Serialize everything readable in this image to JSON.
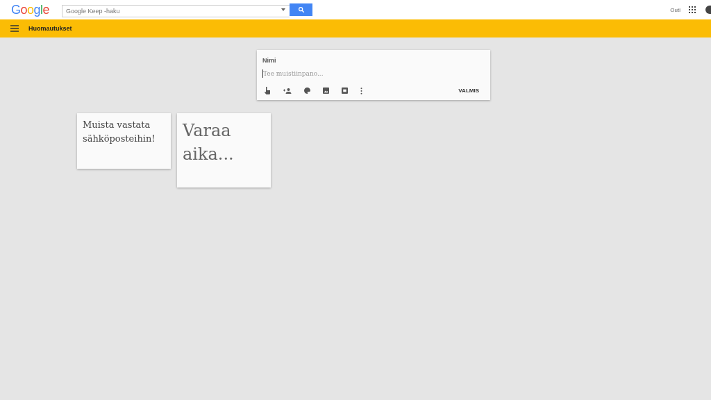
{
  "header": {
    "logo": "Google",
    "search": {
      "placeholder": "Google Keep -haku"
    },
    "user": "Outi"
  },
  "toolbar": {
    "title": "Huomautukset"
  },
  "editor": {
    "title": {
      "placeholder": "Nimi"
    },
    "placeholder": "Tee muistiinpano...",
    "done": "VALMIS",
    "tools": [
      {
        "kind": "hand"
      },
      {
        "kind": "person-add"
      },
      {
        "kind": "palette"
      },
      {
        "kind": "image"
      },
      {
        "kind": "archive"
      },
      {
        "kind": "more"
      }
    ]
  },
  "notes": [
    {
      "text": "Muista vastata sähköposteihin!",
      "kind": "small"
    },
    {
      "text": "Varaa aika...",
      "kind": "large"
    }
  ]
}
